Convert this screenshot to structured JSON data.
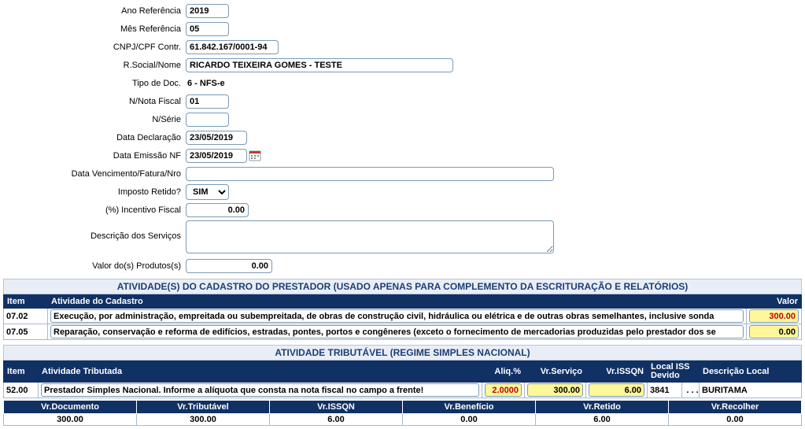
{
  "form": {
    "ano_ref": {
      "label": "Ano Referência",
      "value": "2019"
    },
    "mes_ref": {
      "label": "Mês Referência",
      "value": "05"
    },
    "cnpj": {
      "label": "CNPJ/CPF Contr.",
      "value": "61.842.167/0001-94"
    },
    "rsocial": {
      "label": "R.Social/Nome",
      "value": "RICARDO TEIXEIRA GOMES - TESTE"
    },
    "tipo_doc": {
      "label": "Tipo de Doc.",
      "value": "6 - NFS-e"
    },
    "n_nota": {
      "label": "N/Nota Fiscal",
      "value": "01"
    },
    "n_serie": {
      "label": "N/Série",
      "value": ""
    },
    "data_decl": {
      "label": "Data Declaração",
      "value": "23/05/2019"
    },
    "data_emiss": {
      "label": "Data Emissão NF",
      "value": "23/05/2019"
    },
    "data_venc": {
      "label": "Data Vencimento/Fatura/Nro",
      "value": ""
    },
    "imposto_retido": {
      "label": "Imposto Retido?",
      "value": "SIM"
    },
    "incentivo": {
      "label": "(%) Incentivo Fiscal",
      "value": "0.00"
    },
    "desc_serv": {
      "label": "Descrição dos Serviços",
      "value": ""
    },
    "valor_prod": {
      "label": "Valor do(s) Produtos(s)",
      "value": "0.00"
    }
  },
  "section1": {
    "title": "ATIVIDADE(S) DO CADASTRO DO PRESTADOR (USADO APENAS PARA COMPLEMENTO DA ESCRITURAÇÃO E RELATÓRIOS)",
    "headers": {
      "item": "Item",
      "atividade": "Atividade do Cadastro",
      "valor": "Valor"
    },
    "rows": [
      {
        "item": "07.02",
        "atividade": "Execução, por administração, empreitada ou subempreitada, de obras de construção civil, hidráulica ou elétrica e de outras obras semelhantes, inclusive sonda",
        "valor": "300.00"
      },
      {
        "item": "07.05",
        "atividade": "Reparação, conservação e reforma de edifícios, estradas, pontes, portos e congêneres (exceto o fornecimento de mercadorias produzidas pelo prestador dos se",
        "valor": "0.00"
      }
    ]
  },
  "section2": {
    "title": "ATIVIDADE TRIBUTÁVEL (REGIME SIMPLES NACIONAL)",
    "headers": {
      "item": "Item",
      "atividade": "Atividade Tributada",
      "aliq": "Aliq.%",
      "vrserv": "Vr.Serviço",
      "vrissqn": "Vr.ISSQN",
      "localiss": "Local ISS Devido",
      "desclocal": "Descrição Local"
    },
    "rows": [
      {
        "item": "52.00",
        "atividade": "Prestador Simples Nacional. Informe a alíquota que consta na nota fiscal no campo a frente!",
        "aliq": "2.0000",
        "vrserv": "300.00",
        "vrissqn": "6.00",
        "localcode": "3841",
        "localdesc": "BURITAMA"
      }
    ]
  },
  "totals": {
    "headers": {
      "doc": "Vr.Documento",
      "trib": "Vr.Tributável",
      "issqn": "Vr.ISSQN",
      "benef": "Vr.Benefício",
      "retido": "Vr.Retido",
      "recolher": "Vr.Recolher"
    },
    "values": {
      "doc": "300.00",
      "trib": "300.00",
      "issqn": "6.00",
      "benef": "0.00",
      "retido": "6.00",
      "recolher": "0.00"
    }
  }
}
